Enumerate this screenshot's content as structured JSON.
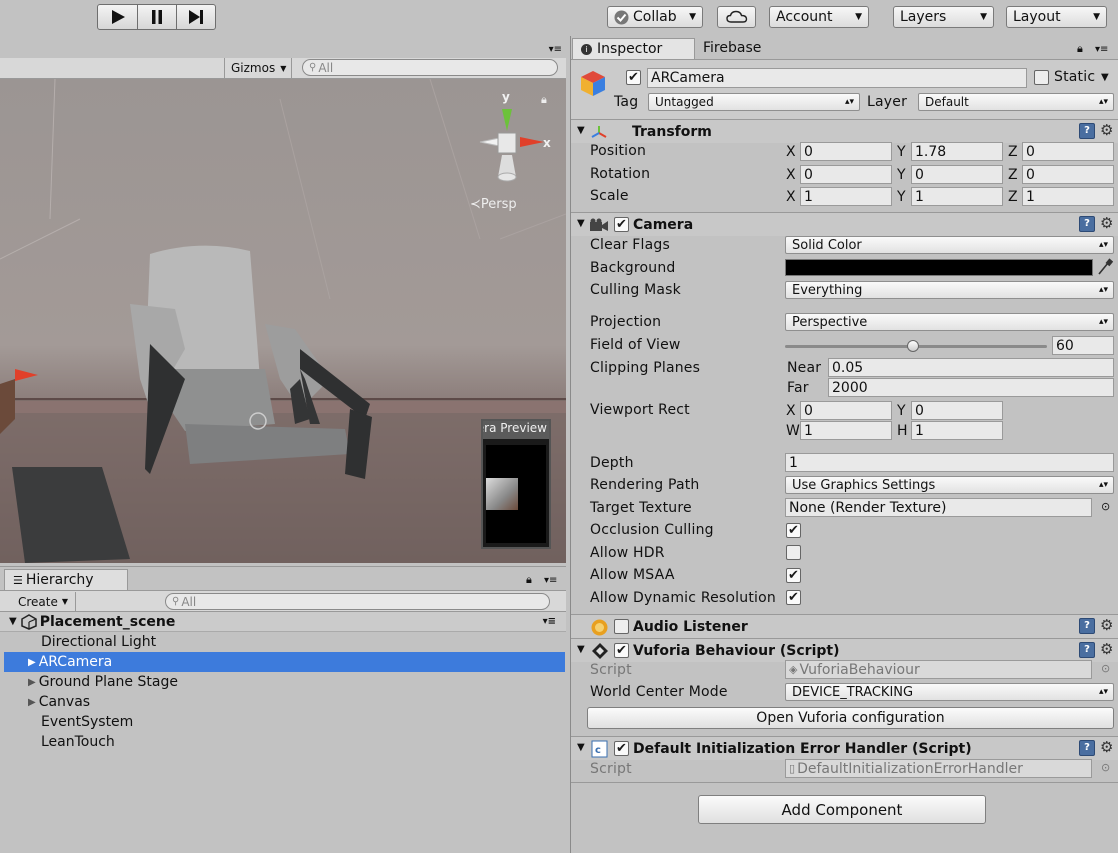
{
  "toolbar": {
    "collab_label": "Collab",
    "account_label": "Account",
    "layers_label": "Layers",
    "layout_label": "Layout"
  },
  "scene": {
    "gizmos_label": "Gizmos",
    "search_placeholder": "All",
    "persp_label": "Persp",
    "axis_x": "x",
    "axis_y": "y",
    "camera_preview_title": "Camera Preview"
  },
  "hierarchy": {
    "tab_label": "Hierarchy",
    "create_label": "Create",
    "search_placeholder": "All",
    "scene_name": "Placement_scene",
    "items": [
      {
        "label": "Directional Light"
      },
      {
        "label": "ARCamera"
      },
      {
        "label": "Ground Plane Stage"
      },
      {
        "label": "Canvas"
      },
      {
        "label": "EventSystem"
      },
      {
        "label": "LeanTouch"
      }
    ]
  },
  "inspector": {
    "tabs": [
      "Inspector",
      "Firebase"
    ],
    "object_name": "ARCamera",
    "static_label": "Static",
    "tag_label": "Tag",
    "tag_value": "Untagged",
    "layer_label": "Layer",
    "layer_value": "Default",
    "transform": {
      "title": "Transform",
      "position_label": "Position",
      "rotation_label": "Rotation",
      "scale_label": "Scale",
      "position": [
        "0",
        "1.78",
        "0"
      ],
      "rotation": [
        "0",
        "0",
        "0"
      ],
      "scale": [
        "1",
        "1",
        "1"
      ],
      "x": "X",
      "y": "Y",
      "z": "Z"
    },
    "camera": {
      "title": "Camera",
      "clear_flags_label": "Clear Flags",
      "clear_flags_value": "Solid Color",
      "background_label": "Background",
      "culling_mask_label": "Culling Mask",
      "culling_mask_value": "Everything",
      "projection_label": "Projection",
      "projection_value": "Perspective",
      "fov_label": "Field of View",
      "fov_value": "60",
      "fov_fraction": 0.49,
      "clipping_label": "Clipping Planes",
      "near_label": "Near",
      "near_value": "0.05",
      "far_label": "Far",
      "far_value": "2000",
      "viewport_label": "Viewport Rect",
      "vp_x": "0",
      "vp_y": "0",
      "vp_w": "1",
      "vp_h": "1",
      "w": "W",
      "h": "H",
      "depth_label": "Depth",
      "depth_value": "1",
      "rendering_path_label": "Rendering Path",
      "rendering_path_value": "Use Graphics Settings",
      "target_texture_label": "Target Texture",
      "target_texture_value": "None (Render Texture)",
      "occlusion_label": "Occlusion Culling",
      "hdr_label": "Allow HDR",
      "msaa_label": "Allow MSAA",
      "dynres_label": "Allow Dynamic Resolution",
      "background_color": "#000000"
    },
    "audio_listener": {
      "title": "Audio Listener"
    },
    "vuforia": {
      "title": "Vuforia Behaviour (Script)",
      "script_label": "Script",
      "script_value": "VuforiaBehaviour",
      "world_center_label": "World Center Mode",
      "world_center_value": "DEVICE_TRACKING",
      "open_config_label": "Open Vuforia configuration"
    },
    "error_handler": {
      "title": "Default Initialization Error Handler (Script)",
      "script_label": "Script",
      "script_value": "DefaultInitializationErrorHandler"
    },
    "add_component_label": "Add Component"
  },
  "colors": {
    "selection": "#3d7bdc",
    "accent_red": "#e0402a",
    "accent_green": "#6cc23a",
    "book_blue": "#4a6ea0"
  }
}
